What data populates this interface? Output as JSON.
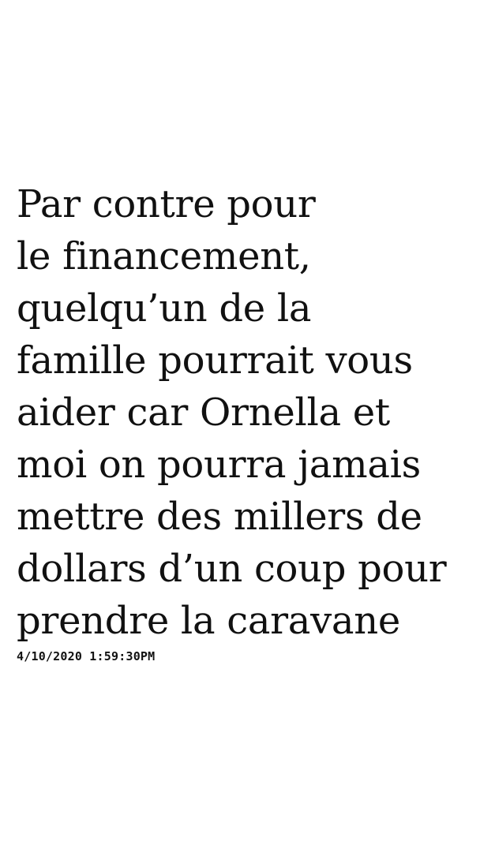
{
  "message": {
    "lines": [
      "Par contre pour",
      "le financement,",
      "quelqu’un de la",
      "famille pourrait vous",
      "aider car Ornella et",
      "moi on pourra jamais",
      "mettre des millers de",
      "dollars d’un coup pour",
      "prendre la caravane"
    ],
    "timestamp": "4/10/2020 1:59:30PM"
  },
  "colors": {
    "background": "#ffffff",
    "text": "#111111"
  }
}
